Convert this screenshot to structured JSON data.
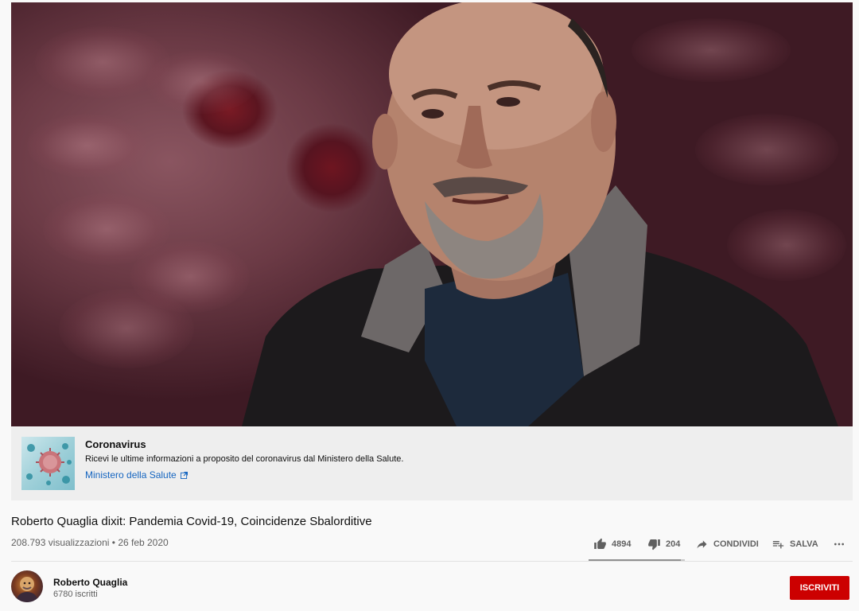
{
  "info_panel": {
    "title": "Coronavirus",
    "description": "Ricevi le ultime informazioni a proposito del coronavirus dal Ministero della Salute.",
    "link_label": "Ministero della Salute",
    "thumb_icon": "virus-image",
    "link_icon": "external-link-icon"
  },
  "video": {
    "title": "Roberto Quaglia dixit: Pandemia Covid-19, Coincidenze Sbalorditive",
    "views": "208.793 visualizzazioni",
    "separator": "•",
    "date": "26 feb 2020"
  },
  "actions": {
    "likes": "4894",
    "dislikes": "204",
    "share_label": "CONDIVIDI",
    "save_label": "SALVA",
    "like_ratio": 0.96
  },
  "channel": {
    "name": "Roberto Quaglia",
    "subscribers": "6780 iscritti",
    "subscribe_label": "ISCRIVITI"
  },
  "colors": {
    "subscribe_bg": "#cc0000",
    "link": "#1565c0",
    "background": "#f9f9f9"
  }
}
